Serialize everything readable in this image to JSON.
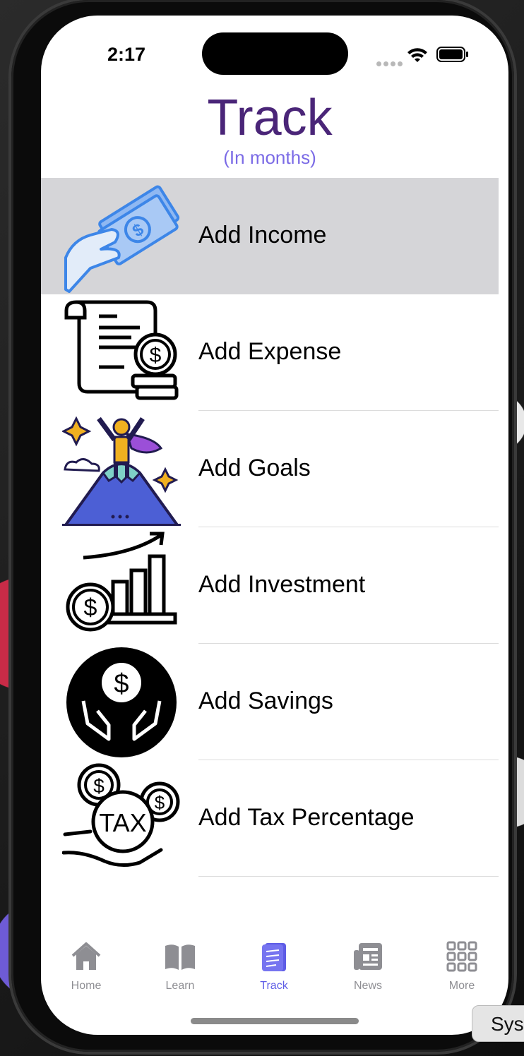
{
  "status": {
    "time": "2:17"
  },
  "header": {
    "title": "Track",
    "subtitle": "(In months)"
  },
  "items": [
    {
      "label": "Add Income",
      "selected": true
    },
    {
      "label": "Add Expense"
    },
    {
      "label": "Add Goals"
    },
    {
      "label": "Add Investment"
    },
    {
      "label": "Add Savings"
    },
    {
      "label": "Add Tax Percentage"
    }
  ],
  "tabs": [
    {
      "label": "Home",
      "icon": "house-icon"
    },
    {
      "label": "Learn",
      "icon": "book-icon"
    },
    {
      "label": "Track",
      "icon": "notepad-icon",
      "active": true
    },
    {
      "label": "News",
      "icon": "newspaper-icon"
    },
    {
      "label": "More",
      "icon": "grid-icon"
    }
  ],
  "overlay": {
    "chip": "Syst"
  },
  "colors": {
    "title": "#4a2578",
    "subtitle": "#7b6be6",
    "accent": "#5e5ce6",
    "selected_row": "#d5d5d8"
  }
}
